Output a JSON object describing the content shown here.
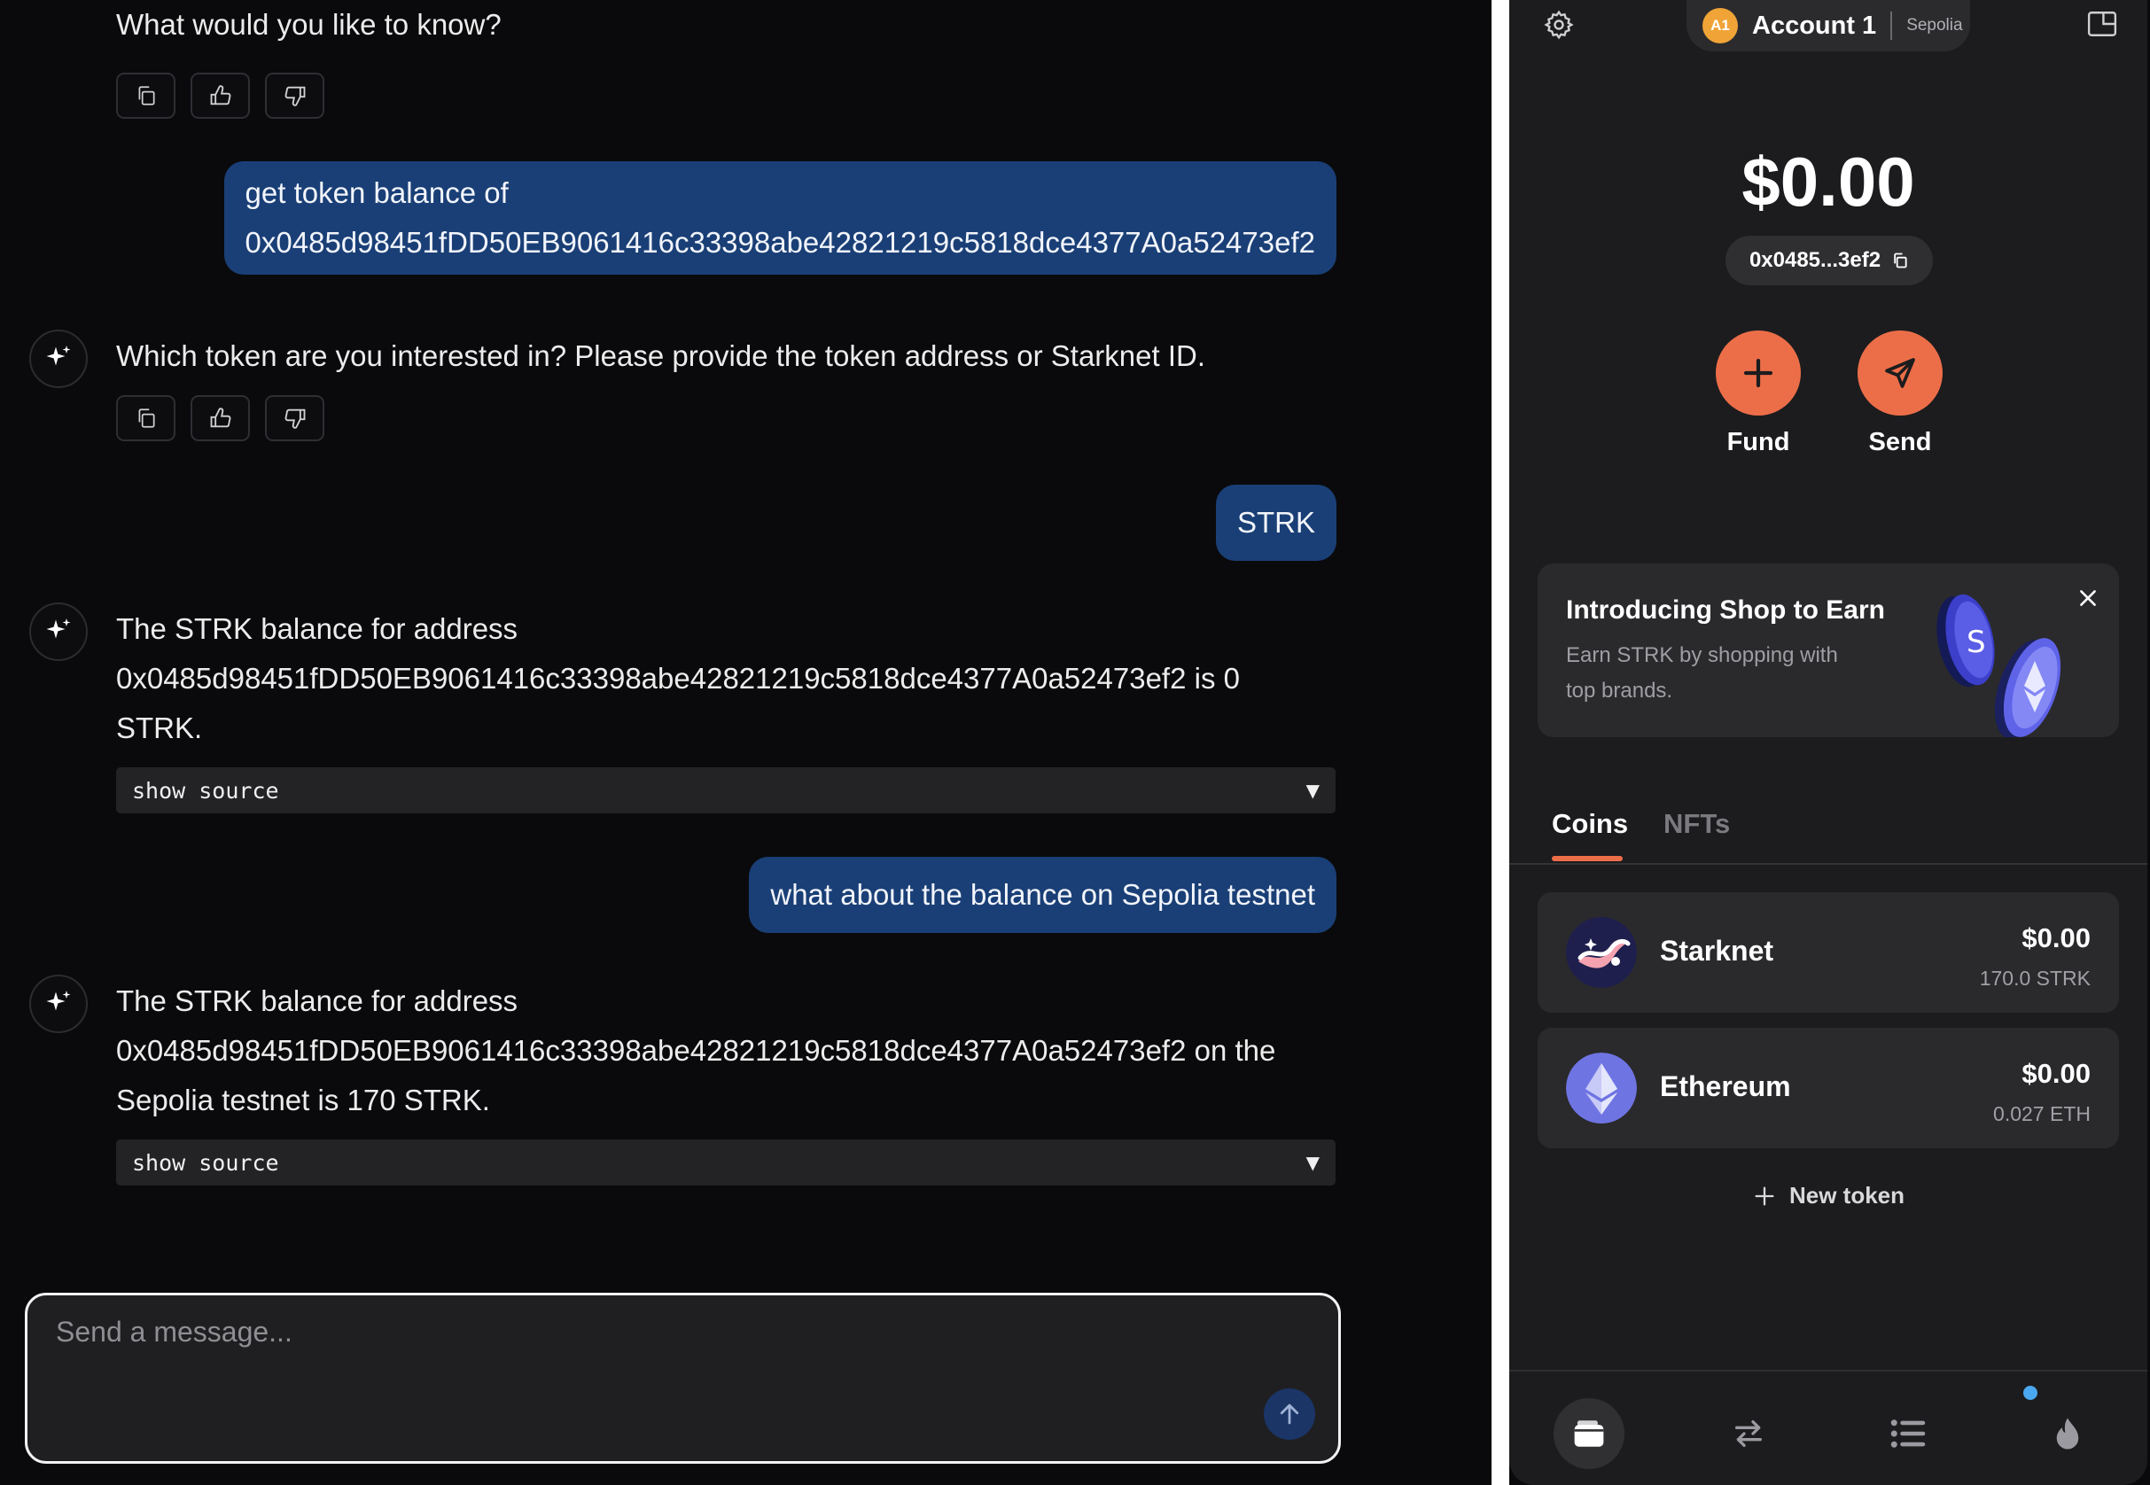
{
  "chat": {
    "messages": [
      {
        "role": "assistant",
        "text": "What would you like to know?"
      },
      {
        "role": "user",
        "lines": [
          "get token balance of",
          "0x0485d98451fDD50EB9061416c33398abe42821219c5818dce4377A0a52473ef2"
        ]
      },
      {
        "role": "assistant",
        "text": "Which token are you interested in? Please provide the token address or Starknet ID."
      },
      {
        "role": "user",
        "text": "STRK"
      },
      {
        "role": "assistant",
        "lines": [
          "The STRK balance for address",
          "0x0485d98451fDD50EB9061416c33398abe42821219c5818dce4377A0a52473ef2 is 0",
          "STRK."
        ],
        "source_label": "show source"
      },
      {
        "role": "user",
        "text": "what about the balance on Sepolia testnet"
      },
      {
        "role": "assistant",
        "lines": [
          "The STRK balance for address",
          "0x0485d98451fDD50EB9061416c33398abe42821219c5818dce4377A0a52473ef2 on the",
          "Sepolia testnet is 170 STRK."
        ],
        "source_label": "show source"
      }
    ],
    "composer": {
      "placeholder": "Send a message..."
    }
  },
  "wallet": {
    "account": {
      "badge": "A1",
      "name": "Account 1",
      "network": "Sepolia"
    },
    "balance": "$0.00",
    "address_short": "0x0485...3ef2",
    "actions": [
      {
        "label": "Fund"
      },
      {
        "label": "Send"
      }
    ],
    "promo": {
      "title": "Introducing Shop to Earn",
      "description": "Earn STRK by shopping with top brands."
    },
    "tabs": [
      {
        "label": "Coins",
        "active": true
      },
      {
        "label": "NFTs",
        "active": false
      }
    ],
    "coins": [
      {
        "name": "Starknet",
        "usd": "$0.00",
        "amount": "170.0 STRK"
      },
      {
        "name": "Ethereum",
        "usd": "$0.00",
        "amount": "0.027 ETH"
      }
    ],
    "new_token_label": "New token"
  },
  "colors": {
    "accent": "#ec6e48",
    "user_bubble": "#1a3f76",
    "badge": "#f0a437"
  }
}
